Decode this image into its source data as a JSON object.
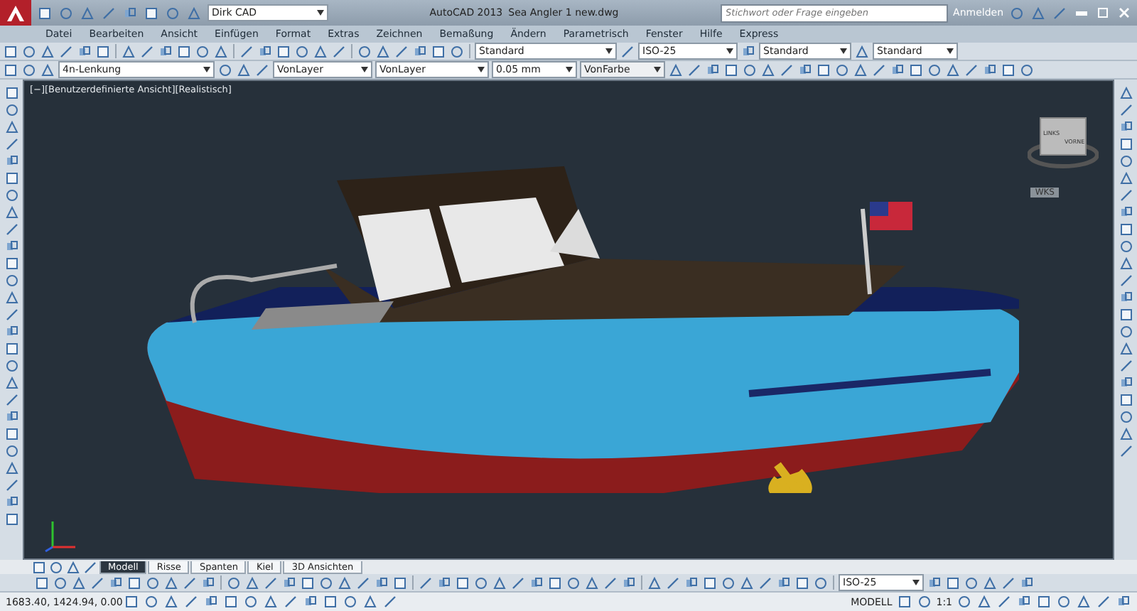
{
  "titlebar": {
    "workspace": "Dirk CAD",
    "app": "AutoCAD 2013",
    "file": "Sea Angler 1 new.dwg",
    "search": {
      "placeholder": "Stichwort oder Frage eingeben"
    },
    "signin": "Anmelden"
  },
  "menu": [
    "Datei",
    "Bearbeiten",
    "Ansicht",
    "Einfügen",
    "Format",
    "Extras",
    "Zeichnen",
    "Bemaßung",
    "Ändern",
    "Parametrisch",
    "Fenster",
    "Hilfe",
    "Express"
  ],
  "toolbar_1": {
    "text_style": "Standard",
    "dim_style": "ISO-25",
    "table_style": "Standard",
    "mleader_style": "Standard"
  },
  "toolbar_2": {
    "layer": "4n-Lenkung",
    "color_control": "VonLayer",
    "linetype": "VonLayer",
    "lineweight": "0.05 mm",
    "plotstyle": "VonFarbe"
  },
  "viewport": {
    "label": "[−][Benutzerdefinierte Ansicht][Realistisch]",
    "viewcube": {
      "left": "LINKS",
      "front": "VORNE",
      "ucs": "WKS"
    }
  },
  "tabs": [
    {
      "label": "Modell",
      "selected": true
    },
    {
      "label": "Risse",
      "selected": false
    },
    {
      "label": "Spanten",
      "selected": false
    },
    {
      "label": "Kiel",
      "selected": false
    },
    {
      "label": "3D Ansichten",
      "selected": false
    }
  ],
  "bottom_toolbar": {
    "dim_style": "ISO-25"
  },
  "status_bar": {
    "coordinates": "1683.40, 1424.94, 0.00",
    "space": "MODELL",
    "scale": "1:1"
  }
}
